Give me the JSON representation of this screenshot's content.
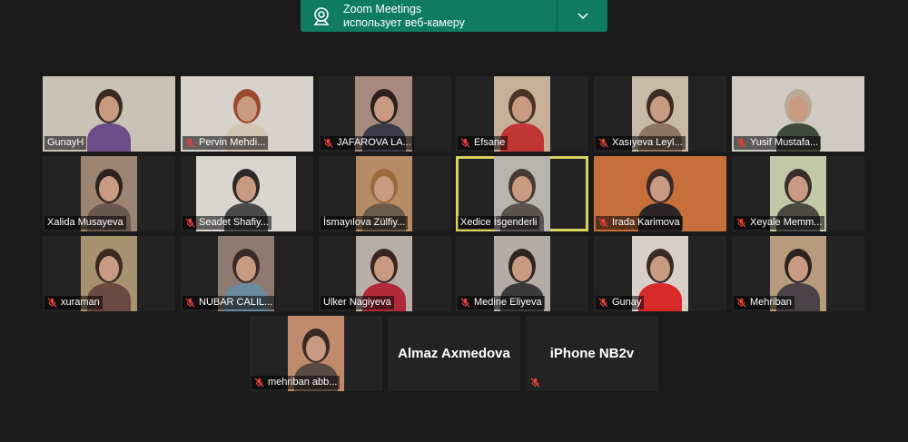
{
  "notification": {
    "app": "Zoom Meetings",
    "message": "использует веб-камеру",
    "icon": "webcam-icon",
    "color": "#0f7c5f"
  },
  "participants": [
    {
      "name": "GunayH",
      "muted": false,
      "video": true
    },
    {
      "name": "Pervin Mehdi...",
      "muted": true,
      "video": true
    },
    {
      "name": "JAFAROVA LA...",
      "muted": true,
      "video": true
    },
    {
      "name": "Efsane",
      "muted": true,
      "video": true
    },
    {
      "name": "Xasıyeva Leyl...",
      "muted": true,
      "video": true
    },
    {
      "name": "Yusif Mustafa...",
      "muted": true,
      "video": true
    },
    {
      "name": "Xalida Musayeva",
      "muted": false,
      "video": true
    },
    {
      "name": "Seadet Shafiy...",
      "muted": true,
      "video": true
    },
    {
      "name": "İsmayılova Zülfiy...",
      "muted": false,
      "video": true
    },
    {
      "name": "Xedice İsgenderli",
      "muted": false,
      "video": true,
      "active_speaker": true
    },
    {
      "name": "Irada Karimova",
      "muted": true,
      "video": true
    },
    {
      "name": "Xeyale Memm...",
      "muted": true,
      "video": true
    },
    {
      "name": "xuraman",
      "muted": true,
      "video": true
    },
    {
      "name": "NUBAR CALIL...",
      "muted": true,
      "video": true
    },
    {
      "name": "Ulker Nagiyeva",
      "muted": false,
      "video": true
    },
    {
      "name": "Medine Eliyeva",
      "muted": true,
      "video": true
    },
    {
      "name": "Gunay",
      "muted": true,
      "video": true
    },
    {
      "name": "Mehriban",
      "muted": true,
      "video": true
    },
    {
      "name": "mehriban abb...",
      "muted": true,
      "video": true
    },
    {
      "name": "Almaz Axmedova",
      "muted": false,
      "video": false
    },
    {
      "name": "iPhone NB2v",
      "muted": true,
      "video": false
    }
  ],
  "colors": {
    "background": "#1a1a1a",
    "tile": "#232323",
    "active_border": "#d8d35d",
    "muted_icon": "#e0413b"
  }
}
